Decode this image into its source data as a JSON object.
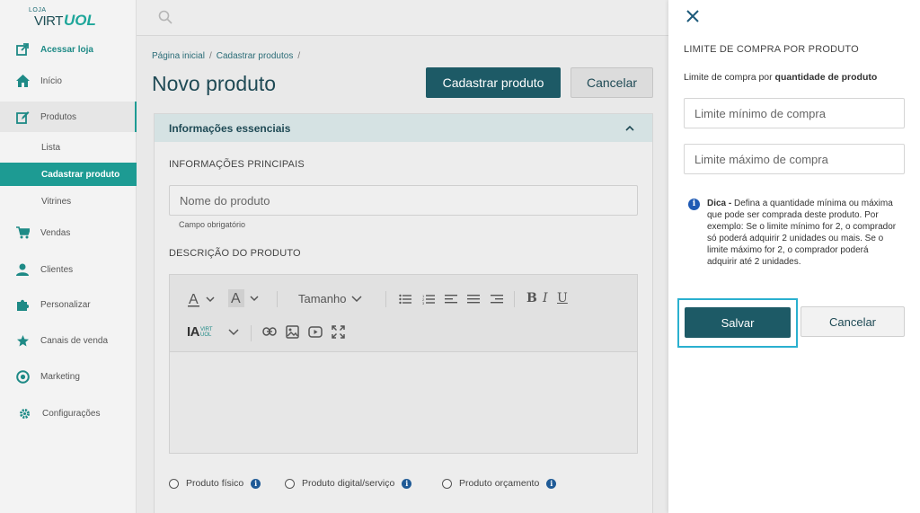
{
  "logo": {
    "loja": "LOJA",
    "virt": "VIRT",
    "uol": "UOL"
  },
  "sidebar": {
    "items": [
      {
        "label": "Acessar loja",
        "icon": "external-link-icon"
      },
      {
        "label": "Início",
        "icon": "home-icon"
      },
      {
        "label": "Produtos",
        "icon": "edit-icon"
      },
      {
        "label": "Vendas",
        "icon": "cart-icon"
      },
      {
        "label": "Clientes",
        "icon": "user-icon"
      },
      {
        "label": "Personalizar",
        "icon": "puzzle-icon"
      },
      {
        "label": "Canais de venda",
        "icon": "star-icon"
      },
      {
        "label": "Marketing",
        "icon": "target-icon"
      },
      {
        "label": "Configurações",
        "icon": "gear-icon"
      }
    ],
    "sub_items": [
      "Lista",
      "Cadastrar produto",
      "Vitrines"
    ]
  },
  "breadcrumb": {
    "home": "Página inicial",
    "current": "Cadastrar produtos",
    "sep": "/"
  },
  "page_title": "Novo produto",
  "actions": {
    "primary": "Cadastrar produto",
    "cancel": "Cancelar"
  },
  "card": {
    "title": "Informações essenciais",
    "main_info_label": "INFORMAÇÕES PRINCIPAIS",
    "name_placeholder": "Nome do produto",
    "required_note": "Campo obrigatório",
    "description_label": "DESCRIÇÃO DO PRODUTO",
    "toolbar": {
      "size_label": "Tamanho",
      "ia_label": "IA",
      "ia_brand": "VIRT UOL"
    },
    "product_types": [
      "Produto físico",
      "Produto digital/serviço",
      "Produto orçamento"
    ]
  },
  "panel": {
    "title": "LIMITE DE COMPRA POR PRODUTO",
    "subtitle_prefix": "Limite de compra por ",
    "subtitle_bold": "quantidade de produto",
    "min_placeholder": "Limite mínimo de compra",
    "max_placeholder": "Limite máximo de compra",
    "tip_bold": "Dica -",
    "tip_text": " Defina a quantidade mínima ou máxima que pode ser comprada deste produto. Por exemplo: Se o limite mínimo for 2, o comprador só poderá adquirir 2 unidades ou mais. Se o limite máximo for 2, o comprador poderá adquirir até 2 unidades.",
    "save_label": "Salvar",
    "cancel_label": "Cancelar"
  },
  "colors": {
    "accent": "#1d9b93",
    "primary_button": "#1d5a66",
    "focus_ring": "#2ab0cf"
  }
}
